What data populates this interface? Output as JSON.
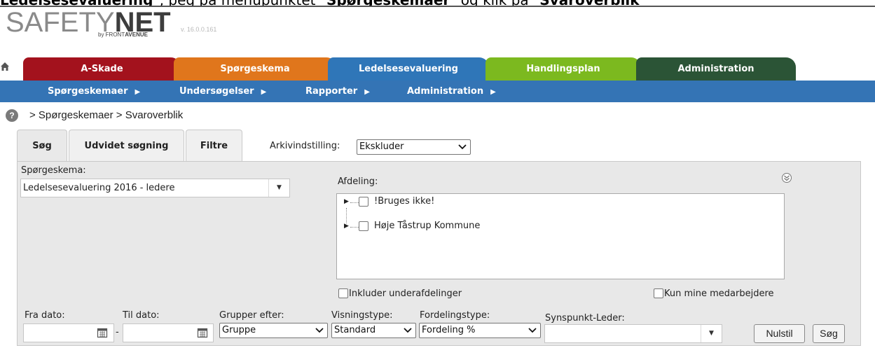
{
  "instruction": {
    "part1": "Ledelsesevaluering",
    "part2": "\", peg på menupunktet \"",
    "part3": "Spørgeskemaer",
    "part4": "\" og klik på \"",
    "part5": "Svaroverblik"
  },
  "app": {
    "logo_light": "SAFETY",
    "logo_bold": "NET",
    "logo_by": "by FRONT",
    "logo_by_bold": "AVENUE",
    "version": "v. 16.0.0.161"
  },
  "main_tabs": [
    {
      "label": "A-Skade",
      "color": "#a3121d"
    },
    {
      "label": "Spørgeskema",
      "color": "#e0761c"
    },
    {
      "label": "Ledelsesevaluering",
      "color": "#2f76b8"
    },
    {
      "label": "Handlingsplan",
      "color": "#7cb91f"
    },
    {
      "label": "Administration",
      "color": "#2b5436"
    }
  ],
  "subnav": [
    {
      "label": "Spørgeskemaer"
    },
    {
      "label": "Undersøgelser"
    },
    {
      "label": "Rapporter"
    },
    {
      "label": "Administration"
    }
  ],
  "breadcrumb": "> Spørgeskemaer > Svaroverblik",
  "search_tabs": [
    {
      "label": "Søg"
    },
    {
      "label": "Udvidet søgning"
    },
    {
      "label": "Filtre"
    }
  ],
  "archive": {
    "label": "Arkivindstilling:",
    "value": "Ekskluder"
  },
  "form": {
    "questionnaire_label": "Spørgeskema:",
    "questionnaire_value": "Ledelsesevaluering 2016 - ledere",
    "department_label": "Afdeling:",
    "tree": [
      {
        "label": "!Bruges ikke!"
      },
      {
        "label": "Høje Tåstrup Kommune"
      }
    ],
    "include_sub_label": "Inkluder underafdelinger",
    "only_mine_label": "Kun mine medarbejdere",
    "from_label": "Fra dato:",
    "to_label": "Til dato:",
    "date_sep": "-",
    "group_label": "Grupper efter:",
    "group_value": "Gruppe",
    "view_label": "Visningstype:",
    "view_value": "Standard",
    "dist_label": "Fordelingstype:",
    "dist_value": "Fordeling %",
    "viewpoint_label": "Synspunkt-Leder:",
    "viewpoint_value": "",
    "reset_label": "Nulstil",
    "search_label": "Søg"
  }
}
